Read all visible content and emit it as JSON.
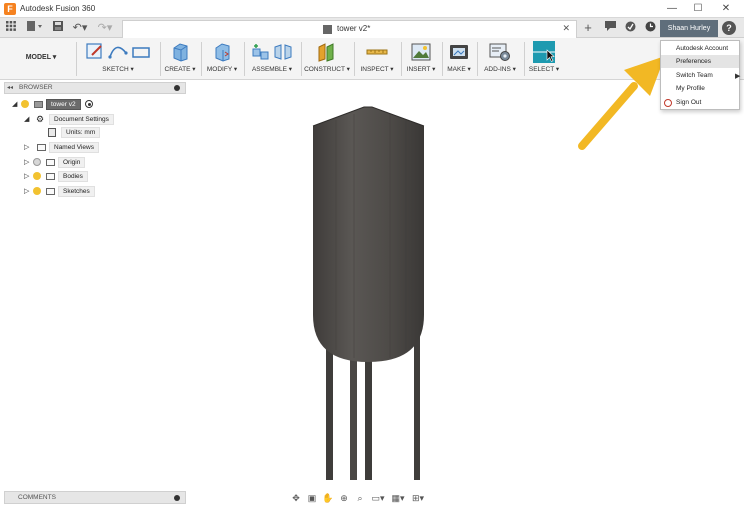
{
  "window": {
    "app_title": "Autodesk Fusion 360",
    "logo_letter": "F",
    "minimize": "—",
    "maximize": "☐",
    "close": "✕"
  },
  "document_tab": {
    "title": "tower v2*",
    "close": "✕"
  },
  "user": {
    "name": "Shaan Hurley",
    "help": "?"
  },
  "user_menu": {
    "items": [
      {
        "label": "Autodesk Account"
      },
      {
        "label": "Preferences"
      },
      {
        "label": "Switch Team"
      },
      {
        "label": "My Profile"
      },
      {
        "label": "Sign Out"
      }
    ]
  },
  "toolbar": {
    "workspace": "MODEL ▾",
    "groups": [
      {
        "label": "SKETCH ▾"
      },
      {
        "label": "CREATE ▾"
      },
      {
        "label": "MODIFY ▾"
      },
      {
        "label": "ASSEMBLE ▾"
      },
      {
        "label": "CONSTRUCT ▾"
      },
      {
        "label": "INSPECT ▾"
      },
      {
        "label": "INSERT ▾"
      },
      {
        "label": "MAKE ▾"
      },
      {
        "label": "ADD-INS ▾"
      },
      {
        "label": "SELECT ▾"
      }
    ]
  },
  "browser": {
    "title": "BROWSER",
    "collapse": "◂◂",
    "tree": {
      "root": "tower v2",
      "document_settings": "Document Settings",
      "units": "Units: mm",
      "named_views": "Named Views",
      "origin": "Origin",
      "bodies": "Bodies",
      "sketches": "Sketches"
    }
  },
  "comments": {
    "title": "COMMENTS"
  },
  "colors": {
    "model": "#4e4b48",
    "arrow": "#f2b824",
    "user_button": "#5f6e7b",
    "select_icon": "#1e9ab0"
  },
  "icons": [
    "grid-icon",
    "file-icon",
    "save-icon",
    "undo-icon",
    "redo-icon",
    "add-tab-icon",
    "notification-icon",
    "job-status-icon",
    "clock-icon",
    "help-icon"
  ]
}
